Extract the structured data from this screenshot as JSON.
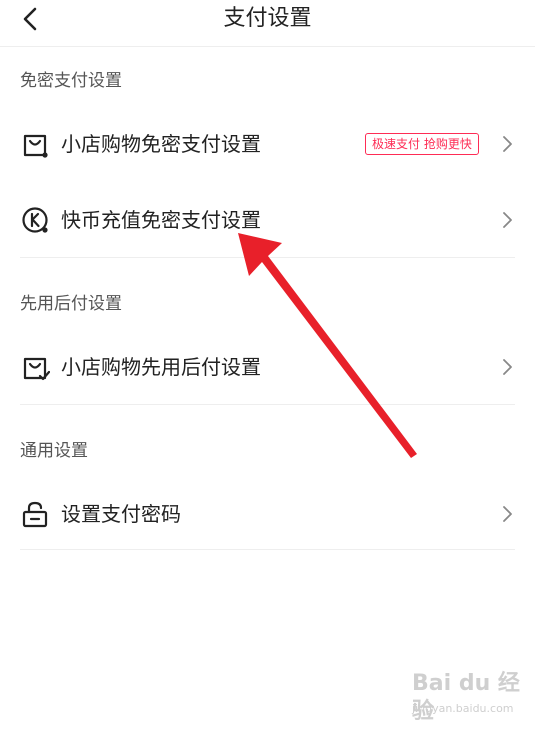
{
  "header": {
    "title": "支付设置"
  },
  "sections": {
    "no_password": {
      "title": "免密支付设置",
      "shop_label": "小店购物免密支付设置",
      "shop_badge": "极速支付 抢购更快",
      "coin_label": "快币充值免密支付设置"
    },
    "pay_later": {
      "title": "先用后付设置",
      "shop_label": "小店购物先用后付设置"
    },
    "general": {
      "title": "通用设置",
      "password_label": "设置支付密码"
    }
  },
  "icons": {
    "back": "chevron-left-icon",
    "shop_bag": "shopping-bag-icon",
    "coin": "kuaibi-coin-icon",
    "shop_bag_check": "shopping-bag-check-icon",
    "lock": "lock-icon",
    "chevron": "chevron-right-icon"
  },
  "watermark": {
    "main": "Bai du 经验",
    "sub": "jingyan.baidu.com"
  },
  "colors": {
    "accent": "#fe2c55",
    "annotation_arrow": "#e8202a",
    "divider": "#eeeeee",
    "section_text": "#555555"
  }
}
